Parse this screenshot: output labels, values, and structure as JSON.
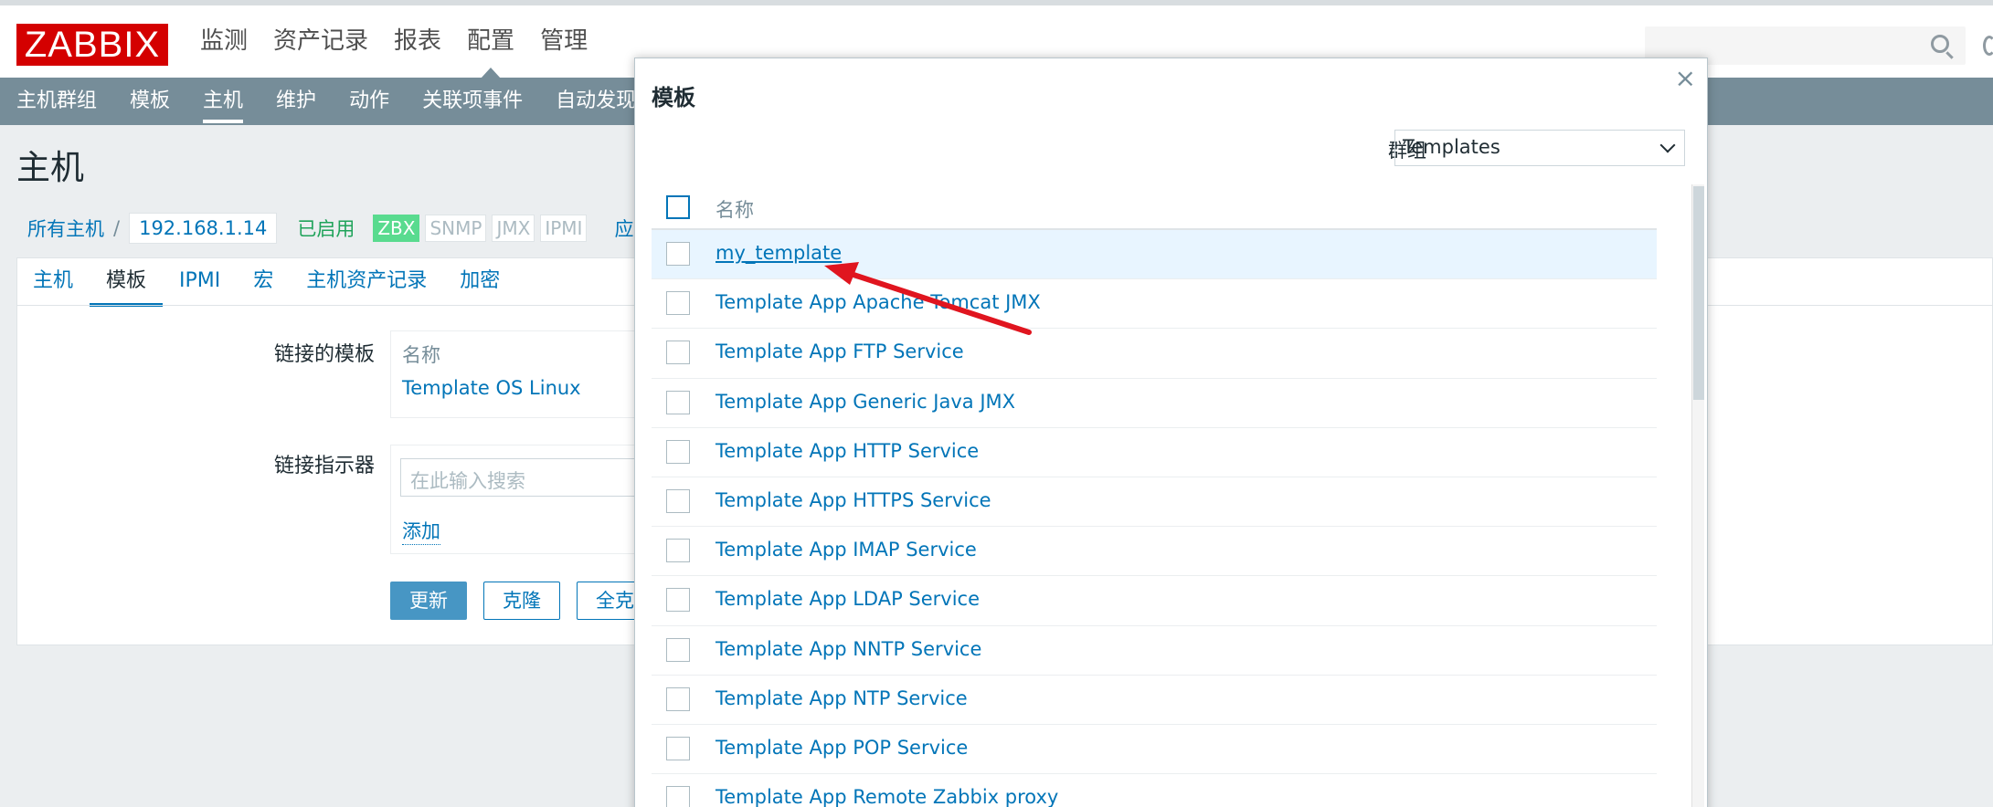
{
  "app": {
    "logo": "ZABBIX"
  },
  "main_menu": [
    "监测",
    "资产记录",
    "报表",
    "配置",
    "管理"
  ],
  "main_menu_active": 3,
  "sub_menu": [
    "主机群组",
    "模板",
    "主机",
    "维护",
    "动作",
    "关联项事件",
    "自动发现"
  ],
  "sub_menu_active": 2,
  "page_title": "主机",
  "breadcrumb": {
    "all_hosts": "所有主机",
    "separator": "/",
    "host": "192.168.1.14",
    "status": "已启用",
    "badges": [
      "ZBX",
      "SNMP",
      "JMX",
      "IPMI"
    ],
    "apps": "应用"
  },
  "tabs": [
    "主机",
    "模板",
    "IPMI",
    "宏",
    "主机资产记录",
    "加密"
  ],
  "tabs_active": 1,
  "form": {
    "linked_label": "链接的模板",
    "linked_head": "名称",
    "linked_item": "Template OS Linux",
    "link_indicator_label": "链接指示器",
    "search_placeholder": "在此输入搜索",
    "add_link": "添加",
    "update_btn": "更新",
    "clone_btn": "克隆",
    "full_clone_btn": "全克"
  },
  "modal": {
    "title": "模板",
    "close": "×",
    "group_label": "群组",
    "group_value": "Templates",
    "col_name": "名称",
    "rows": [
      "my_template",
      "Template App Apache Tomcat JMX",
      "Template App FTP Service",
      "Template App Generic Java JMX",
      "Template App HTTP Service",
      "Template App HTTPS Service",
      "Template App IMAP Service",
      "Template App LDAP Service",
      "Template App NNTP Service",
      "Template App NTP Service",
      "Template App POP Service",
      "Template App Remote Zabbix proxy"
    ],
    "highlighted_row": 0
  },
  "colors": {
    "brand": "#d40000",
    "nav": "#768d99",
    "link": "#0275b8",
    "highlight": "#e8f5ff",
    "arrow": "#e0151f"
  }
}
